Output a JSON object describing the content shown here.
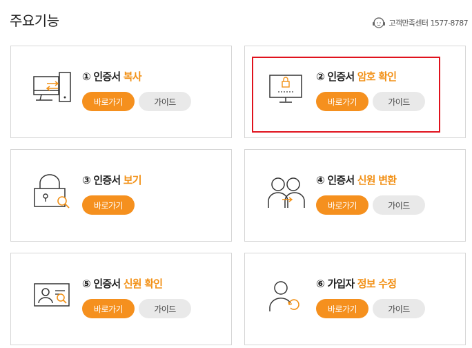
{
  "header": {
    "title": "주요기능",
    "support_label": "고객만족센터",
    "support_phone": "1577-8787"
  },
  "colors": {
    "accent": "#f29117",
    "button_primary": "#f5901e",
    "highlight": "#e0121d"
  },
  "cards": [
    {
      "num": "①",
      "prefix": "인증서",
      "accent": "복사",
      "go_label": "바로가기",
      "guide_label": "가이드",
      "icon": "computer-transfer-icon"
    },
    {
      "num": "②",
      "prefix": "인증서",
      "accent": "암호 확인",
      "go_label": "바로가기",
      "guide_label": "가이드",
      "icon": "monitor-lock-icon"
    },
    {
      "num": "③",
      "prefix": "인증서",
      "accent": "보기",
      "go_label": "바로가기",
      "icon": "lock-search-icon"
    },
    {
      "num": "④",
      "prefix": "인증서",
      "accent": "신원 변환",
      "go_label": "바로가기",
      "guide_label": "가이드",
      "icon": "users-transfer-icon"
    },
    {
      "num": "⑤",
      "prefix": "인증서",
      "accent": "신원 확인",
      "go_label": "바로가기",
      "guide_label": "가이드",
      "icon": "id-card-search-icon"
    },
    {
      "num": "⑥",
      "prefix": "가입자",
      "accent": "정보 수정",
      "go_label": "바로가기",
      "guide_label": "가이드",
      "icon": "user-refresh-icon"
    }
  ]
}
